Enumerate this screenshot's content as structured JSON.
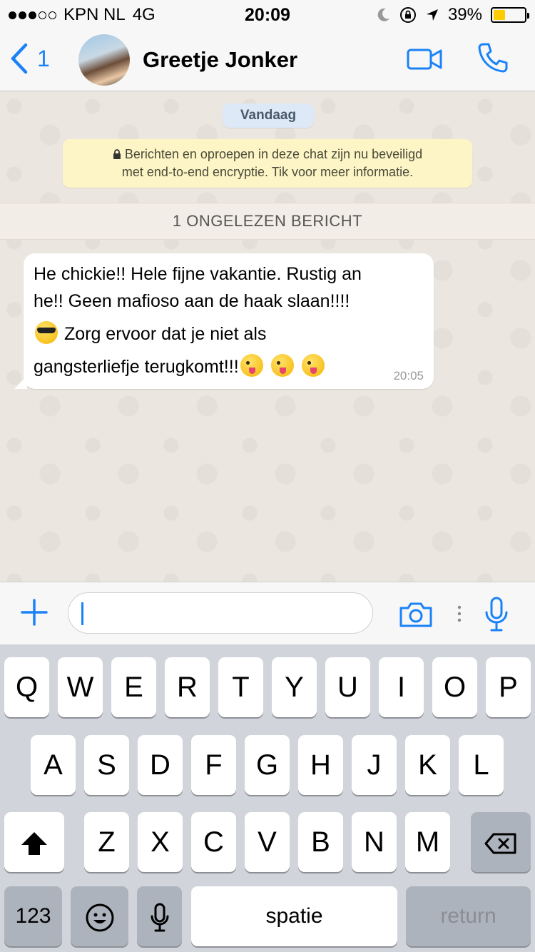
{
  "status_bar": {
    "carrier": "KPN NL",
    "network": "4G",
    "time": "20:09",
    "battery_percent": "39%",
    "battery_level": 0.39,
    "signal_bars": 3,
    "signal_total": 5
  },
  "nav": {
    "back_count": "1",
    "contact_name": "Greetje Jonker"
  },
  "chat": {
    "date_label": "Vandaag",
    "encryption_notice_line1": "Berichten en oproepen in deze chat zijn nu beveiligd",
    "encryption_notice_line2": "met end-to-end encryptie. Tik voor meer informatie.",
    "unread_label": "1 ONGELEZEN BERICHT",
    "message": {
      "line1": "He chickie!! Hele fijne vakantie. Rustig an",
      "line2": "he!! Geen mafioso aan de haak slaan!!!!",
      "line3": "Zorg ervoor dat je niet als",
      "line4": "gangsterliefje terugkomt!!!",
      "time": "20:05"
    }
  },
  "input": {
    "placeholder": ""
  },
  "keyboard": {
    "row1": [
      "Q",
      "W",
      "E",
      "R",
      "T",
      "Y",
      "U",
      "I",
      "O",
      "P"
    ],
    "row2": [
      "A",
      "S",
      "D",
      "F",
      "G",
      "H",
      "J",
      "K",
      "L"
    ],
    "row3": [
      "Z",
      "X",
      "C",
      "V",
      "B",
      "N",
      "M"
    ],
    "numbers_label": "123",
    "space_label": "spatie",
    "return_label": "return"
  },
  "colors": {
    "accent": "#1a82f7",
    "chat_background": "#ebe6df",
    "encryption_box": "#fdf5c5",
    "date_pill": "#dde9f6",
    "battery_fill": "#ffcc00"
  },
  "icons": [
    "back-chevron-icon",
    "video-call-icon",
    "phone-icon",
    "plus-icon",
    "camera-icon",
    "more-dots-icon",
    "microphone-icon",
    "shift-icon",
    "backspace-icon",
    "emoji-icon",
    "dictation-icon",
    "lock-icon",
    "moon-icon",
    "orientation-lock-icon",
    "location-arrow-icon"
  ]
}
